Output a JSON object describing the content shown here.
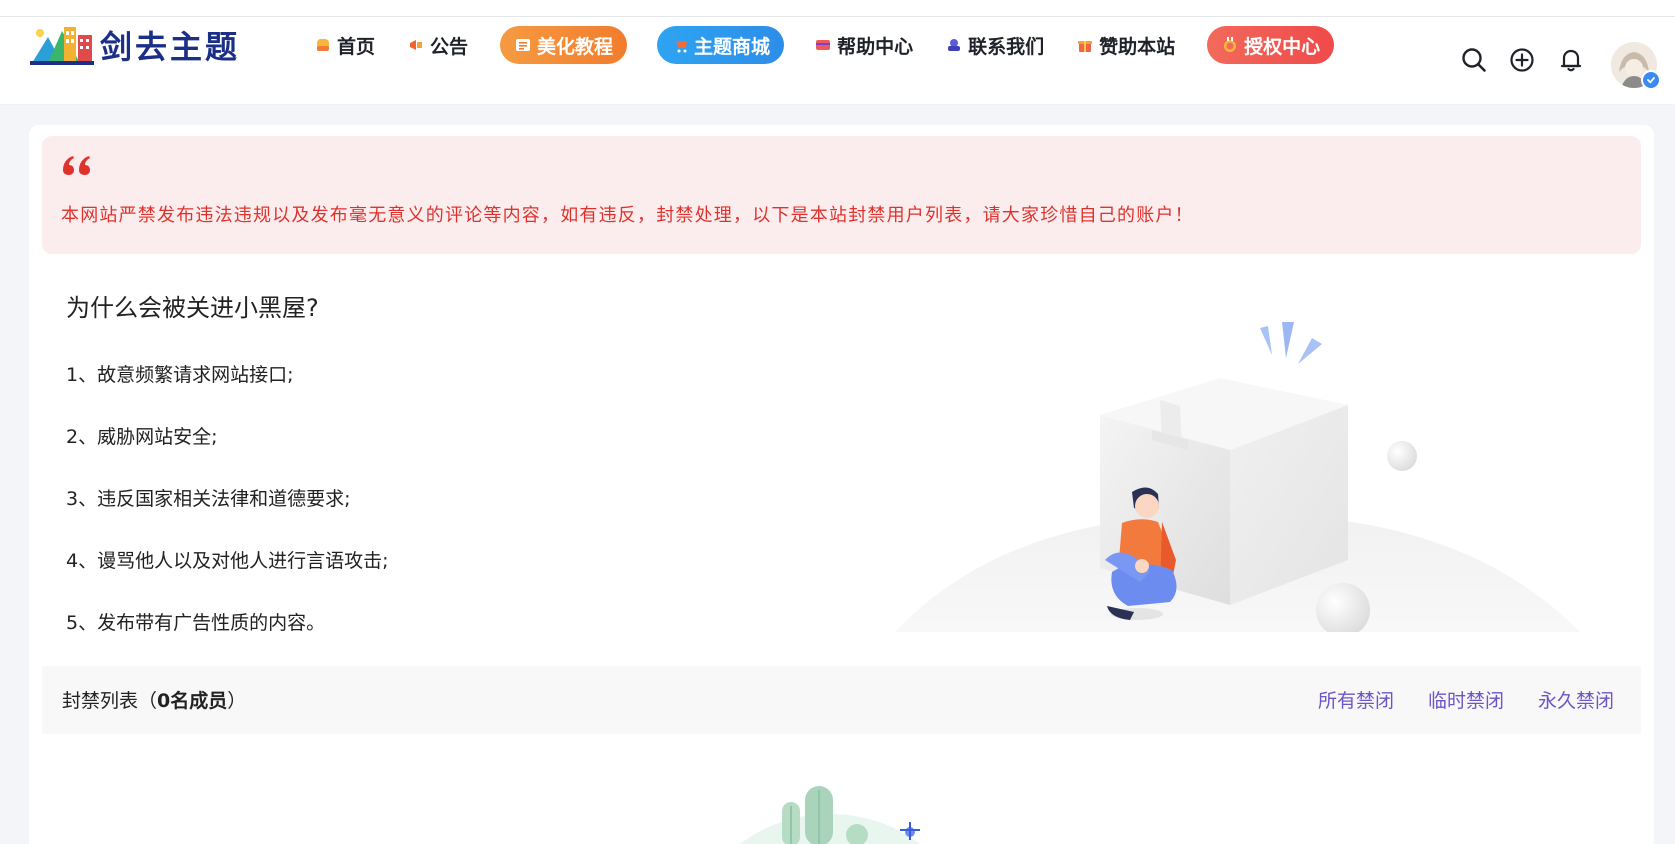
{
  "header": {
    "logo_text": "剑去主题",
    "nav": [
      {
        "label": "首页",
        "icon": "home-icon",
        "color": "#f6b63b"
      },
      {
        "label": "公告",
        "icon": "megaphone-icon",
        "color": "#f2622c"
      },
      {
        "label": "美化教程",
        "icon": "list-icon",
        "color": "#ffffff"
      },
      {
        "label": "主题商城",
        "icon": "cart-icon",
        "color": "#ffffff"
      },
      {
        "label": "帮助中心",
        "icon": "card-icon",
        "color": "#ee5a5a"
      },
      {
        "label": "联系我们",
        "icon": "contact-icon",
        "color": "#5b5ed8"
      },
      {
        "label": "赞助本站",
        "icon": "gift-icon",
        "color": "#f3624a"
      },
      {
        "label": "授权中心",
        "icon": "medal-icon",
        "color": "#ffffff"
      }
    ],
    "icons": [
      "search-icon",
      "add-icon",
      "bell-icon"
    ]
  },
  "notice": {
    "text": "本网站严禁发布违法违规以及发布毫无意义的评论等内容，如有违反，封禁处理，以下是本站封禁用户列表，请大家珍惜自己的账户！",
    "color": "#e0322d"
  },
  "why": {
    "title": "为什么会被关进小黑屋?",
    "reasons": [
      "1、故意频繁请求网站接口;",
      "2、威胁网站安全;",
      "3、违反国家相关法律和道德要求;",
      "4、谩骂他人以及对他人进行言语攻击;",
      "5、发布带有广告性质的内容。"
    ]
  },
  "banlist": {
    "label": "封禁列表（",
    "count": "0名成员",
    "close": "）",
    "filters": [
      "所有禁闭",
      "临时禁闭",
      "永久禁闭"
    ],
    "filter_color": "#6e55c6"
  }
}
